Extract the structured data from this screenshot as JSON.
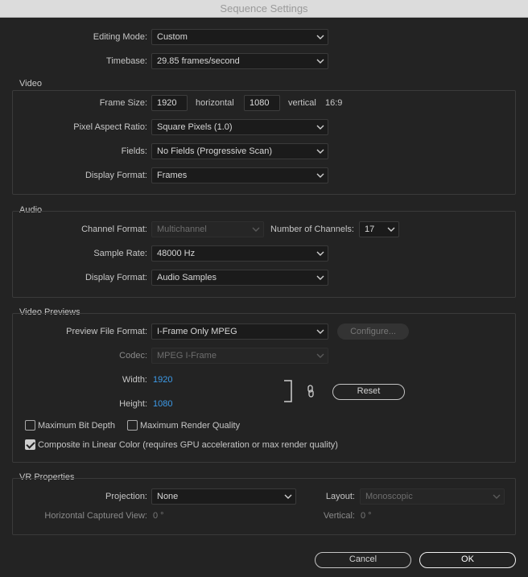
{
  "window": {
    "title": "Sequence Settings"
  },
  "general": {
    "editing_mode_label": "Editing Mode:",
    "editing_mode_value": "Custom",
    "timebase_label": "Timebase:",
    "timebase_value": "29.85  frames/second"
  },
  "video": {
    "title": "Video",
    "frame_size_label": "Frame Size:",
    "frame_width": "1920",
    "horizontal_label": "horizontal",
    "frame_height": "1080",
    "vertical_label": "vertical",
    "aspect": "16:9",
    "pixel_aspect_label": "Pixel Aspect Ratio:",
    "pixel_aspect_value": "Square Pixels (1.0)",
    "fields_label": "Fields:",
    "fields_value": "No Fields (Progressive Scan)",
    "display_format_label": "Display Format:",
    "display_format_value": "Frames"
  },
  "audio": {
    "title": "Audio",
    "channel_format_label": "Channel Format:",
    "channel_format_value": "Multichannel",
    "num_channels_label": "Number of Channels:",
    "num_channels_value": "17",
    "sample_rate_label": "Sample Rate:",
    "sample_rate_value": "48000 Hz",
    "display_format_label": "Display Format:",
    "display_format_value": "Audio Samples"
  },
  "previews": {
    "title": "Video Previews",
    "file_format_label": "Preview File Format:",
    "file_format_value": "I-Frame Only MPEG",
    "configure_label": "Configure...",
    "codec_label": "Codec:",
    "codec_value": "MPEG I-Frame",
    "width_label": "Width:",
    "width_value": "1920",
    "height_label": "Height:",
    "height_value": "1080",
    "reset_label": "Reset",
    "max_bit_depth_label": "Maximum Bit Depth",
    "max_bit_depth_checked": false,
    "max_render_quality_label": "Maximum Render Quality",
    "max_render_quality_checked": false,
    "linear_color_label": "Composite in Linear Color (requires GPU acceleration or max render quality)",
    "linear_color_checked": true
  },
  "vr": {
    "title": "VR Properties",
    "projection_label": "Projection:",
    "projection_value": "None",
    "layout_label": "Layout:",
    "layout_value": "Monoscopic",
    "h_view_label": "Horizontal Captured View:",
    "h_view_value": "0 °",
    "vertical_label": "Vertical:",
    "vertical_value": "0 °"
  },
  "footer": {
    "cancel_label": "Cancel",
    "ok_label": "OK"
  }
}
